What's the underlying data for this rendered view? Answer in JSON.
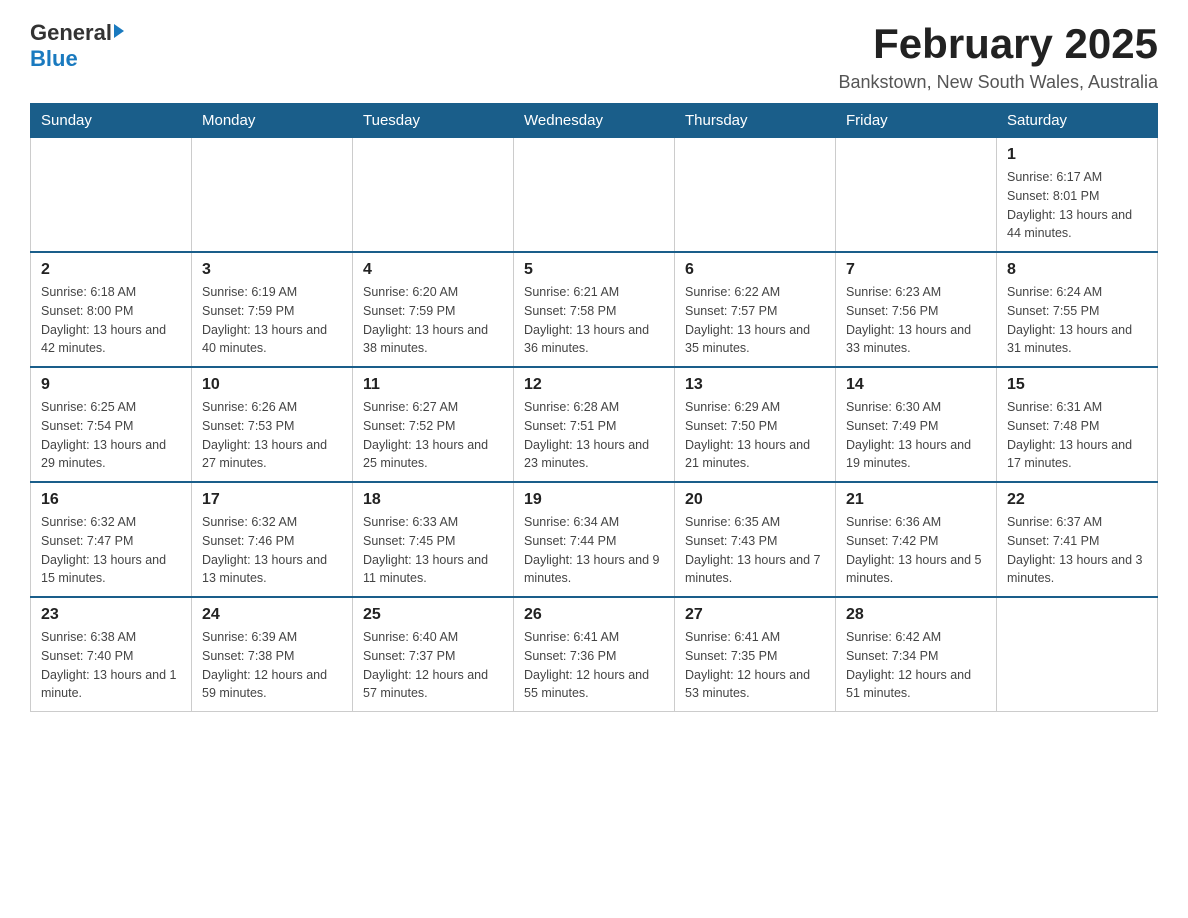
{
  "logo": {
    "general": "General",
    "blue": "Blue"
  },
  "title": "February 2025",
  "location": "Bankstown, New South Wales, Australia",
  "days_of_week": [
    "Sunday",
    "Monday",
    "Tuesday",
    "Wednesday",
    "Thursday",
    "Friday",
    "Saturday"
  ],
  "weeks": [
    [
      {
        "day": "",
        "info": ""
      },
      {
        "day": "",
        "info": ""
      },
      {
        "day": "",
        "info": ""
      },
      {
        "day": "",
        "info": ""
      },
      {
        "day": "",
        "info": ""
      },
      {
        "day": "",
        "info": ""
      },
      {
        "day": "1",
        "info": "Sunrise: 6:17 AM\nSunset: 8:01 PM\nDaylight: 13 hours and 44 minutes."
      }
    ],
    [
      {
        "day": "2",
        "info": "Sunrise: 6:18 AM\nSunset: 8:00 PM\nDaylight: 13 hours and 42 minutes."
      },
      {
        "day": "3",
        "info": "Sunrise: 6:19 AM\nSunset: 7:59 PM\nDaylight: 13 hours and 40 minutes."
      },
      {
        "day": "4",
        "info": "Sunrise: 6:20 AM\nSunset: 7:59 PM\nDaylight: 13 hours and 38 minutes."
      },
      {
        "day": "5",
        "info": "Sunrise: 6:21 AM\nSunset: 7:58 PM\nDaylight: 13 hours and 36 minutes."
      },
      {
        "day": "6",
        "info": "Sunrise: 6:22 AM\nSunset: 7:57 PM\nDaylight: 13 hours and 35 minutes."
      },
      {
        "day": "7",
        "info": "Sunrise: 6:23 AM\nSunset: 7:56 PM\nDaylight: 13 hours and 33 minutes."
      },
      {
        "day": "8",
        "info": "Sunrise: 6:24 AM\nSunset: 7:55 PM\nDaylight: 13 hours and 31 minutes."
      }
    ],
    [
      {
        "day": "9",
        "info": "Sunrise: 6:25 AM\nSunset: 7:54 PM\nDaylight: 13 hours and 29 minutes."
      },
      {
        "day": "10",
        "info": "Sunrise: 6:26 AM\nSunset: 7:53 PM\nDaylight: 13 hours and 27 minutes."
      },
      {
        "day": "11",
        "info": "Sunrise: 6:27 AM\nSunset: 7:52 PM\nDaylight: 13 hours and 25 minutes."
      },
      {
        "day": "12",
        "info": "Sunrise: 6:28 AM\nSunset: 7:51 PM\nDaylight: 13 hours and 23 minutes."
      },
      {
        "day": "13",
        "info": "Sunrise: 6:29 AM\nSunset: 7:50 PM\nDaylight: 13 hours and 21 minutes."
      },
      {
        "day": "14",
        "info": "Sunrise: 6:30 AM\nSunset: 7:49 PM\nDaylight: 13 hours and 19 minutes."
      },
      {
        "day": "15",
        "info": "Sunrise: 6:31 AM\nSunset: 7:48 PM\nDaylight: 13 hours and 17 minutes."
      }
    ],
    [
      {
        "day": "16",
        "info": "Sunrise: 6:32 AM\nSunset: 7:47 PM\nDaylight: 13 hours and 15 minutes."
      },
      {
        "day": "17",
        "info": "Sunrise: 6:32 AM\nSunset: 7:46 PM\nDaylight: 13 hours and 13 minutes."
      },
      {
        "day": "18",
        "info": "Sunrise: 6:33 AM\nSunset: 7:45 PM\nDaylight: 13 hours and 11 minutes."
      },
      {
        "day": "19",
        "info": "Sunrise: 6:34 AM\nSunset: 7:44 PM\nDaylight: 13 hours and 9 minutes."
      },
      {
        "day": "20",
        "info": "Sunrise: 6:35 AM\nSunset: 7:43 PM\nDaylight: 13 hours and 7 minutes."
      },
      {
        "day": "21",
        "info": "Sunrise: 6:36 AM\nSunset: 7:42 PM\nDaylight: 13 hours and 5 minutes."
      },
      {
        "day": "22",
        "info": "Sunrise: 6:37 AM\nSunset: 7:41 PM\nDaylight: 13 hours and 3 minutes."
      }
    ],
    [
      {
        "day": "23",
        "info": "Sunrise: 6:38 AM\nSunset: 7:40 PM\nDaylight: 13 hours and 1 minute."
      },
      {
        "day": "24",
        "info": "Sunrise: 6:39 AM\nSunset: 7:38 PM\nDaylight: 12 hours and 59 minutes."
      },
      {
        "day": "25",
        "info": "Sunrise: 6:40 AM\nSunset: 7:37 PM\nDaylight: 12 hours and 57 minutes."
      },
      {
        "day": "26",
        "info": "Sunrise: 6:41 AM\nSunset: 7:36 PM\nDaylight: 12 hours and 55 minutes."
      },
      {
        "day": "27",
        "info": "Sunrise: 6:41 AM\nSunset: 7:35 PM\nDaylight: 12 hours and 53 minutes."
      },
      {
        "day": "28",
        "info": "Sunrise: 6:42 AM\nSunset: 7:34 PM\nDaylight: 12 hours and 51 minutes."
      },
      {
        "day": "",
        "info": ""
      }
    ]
  ]
}
